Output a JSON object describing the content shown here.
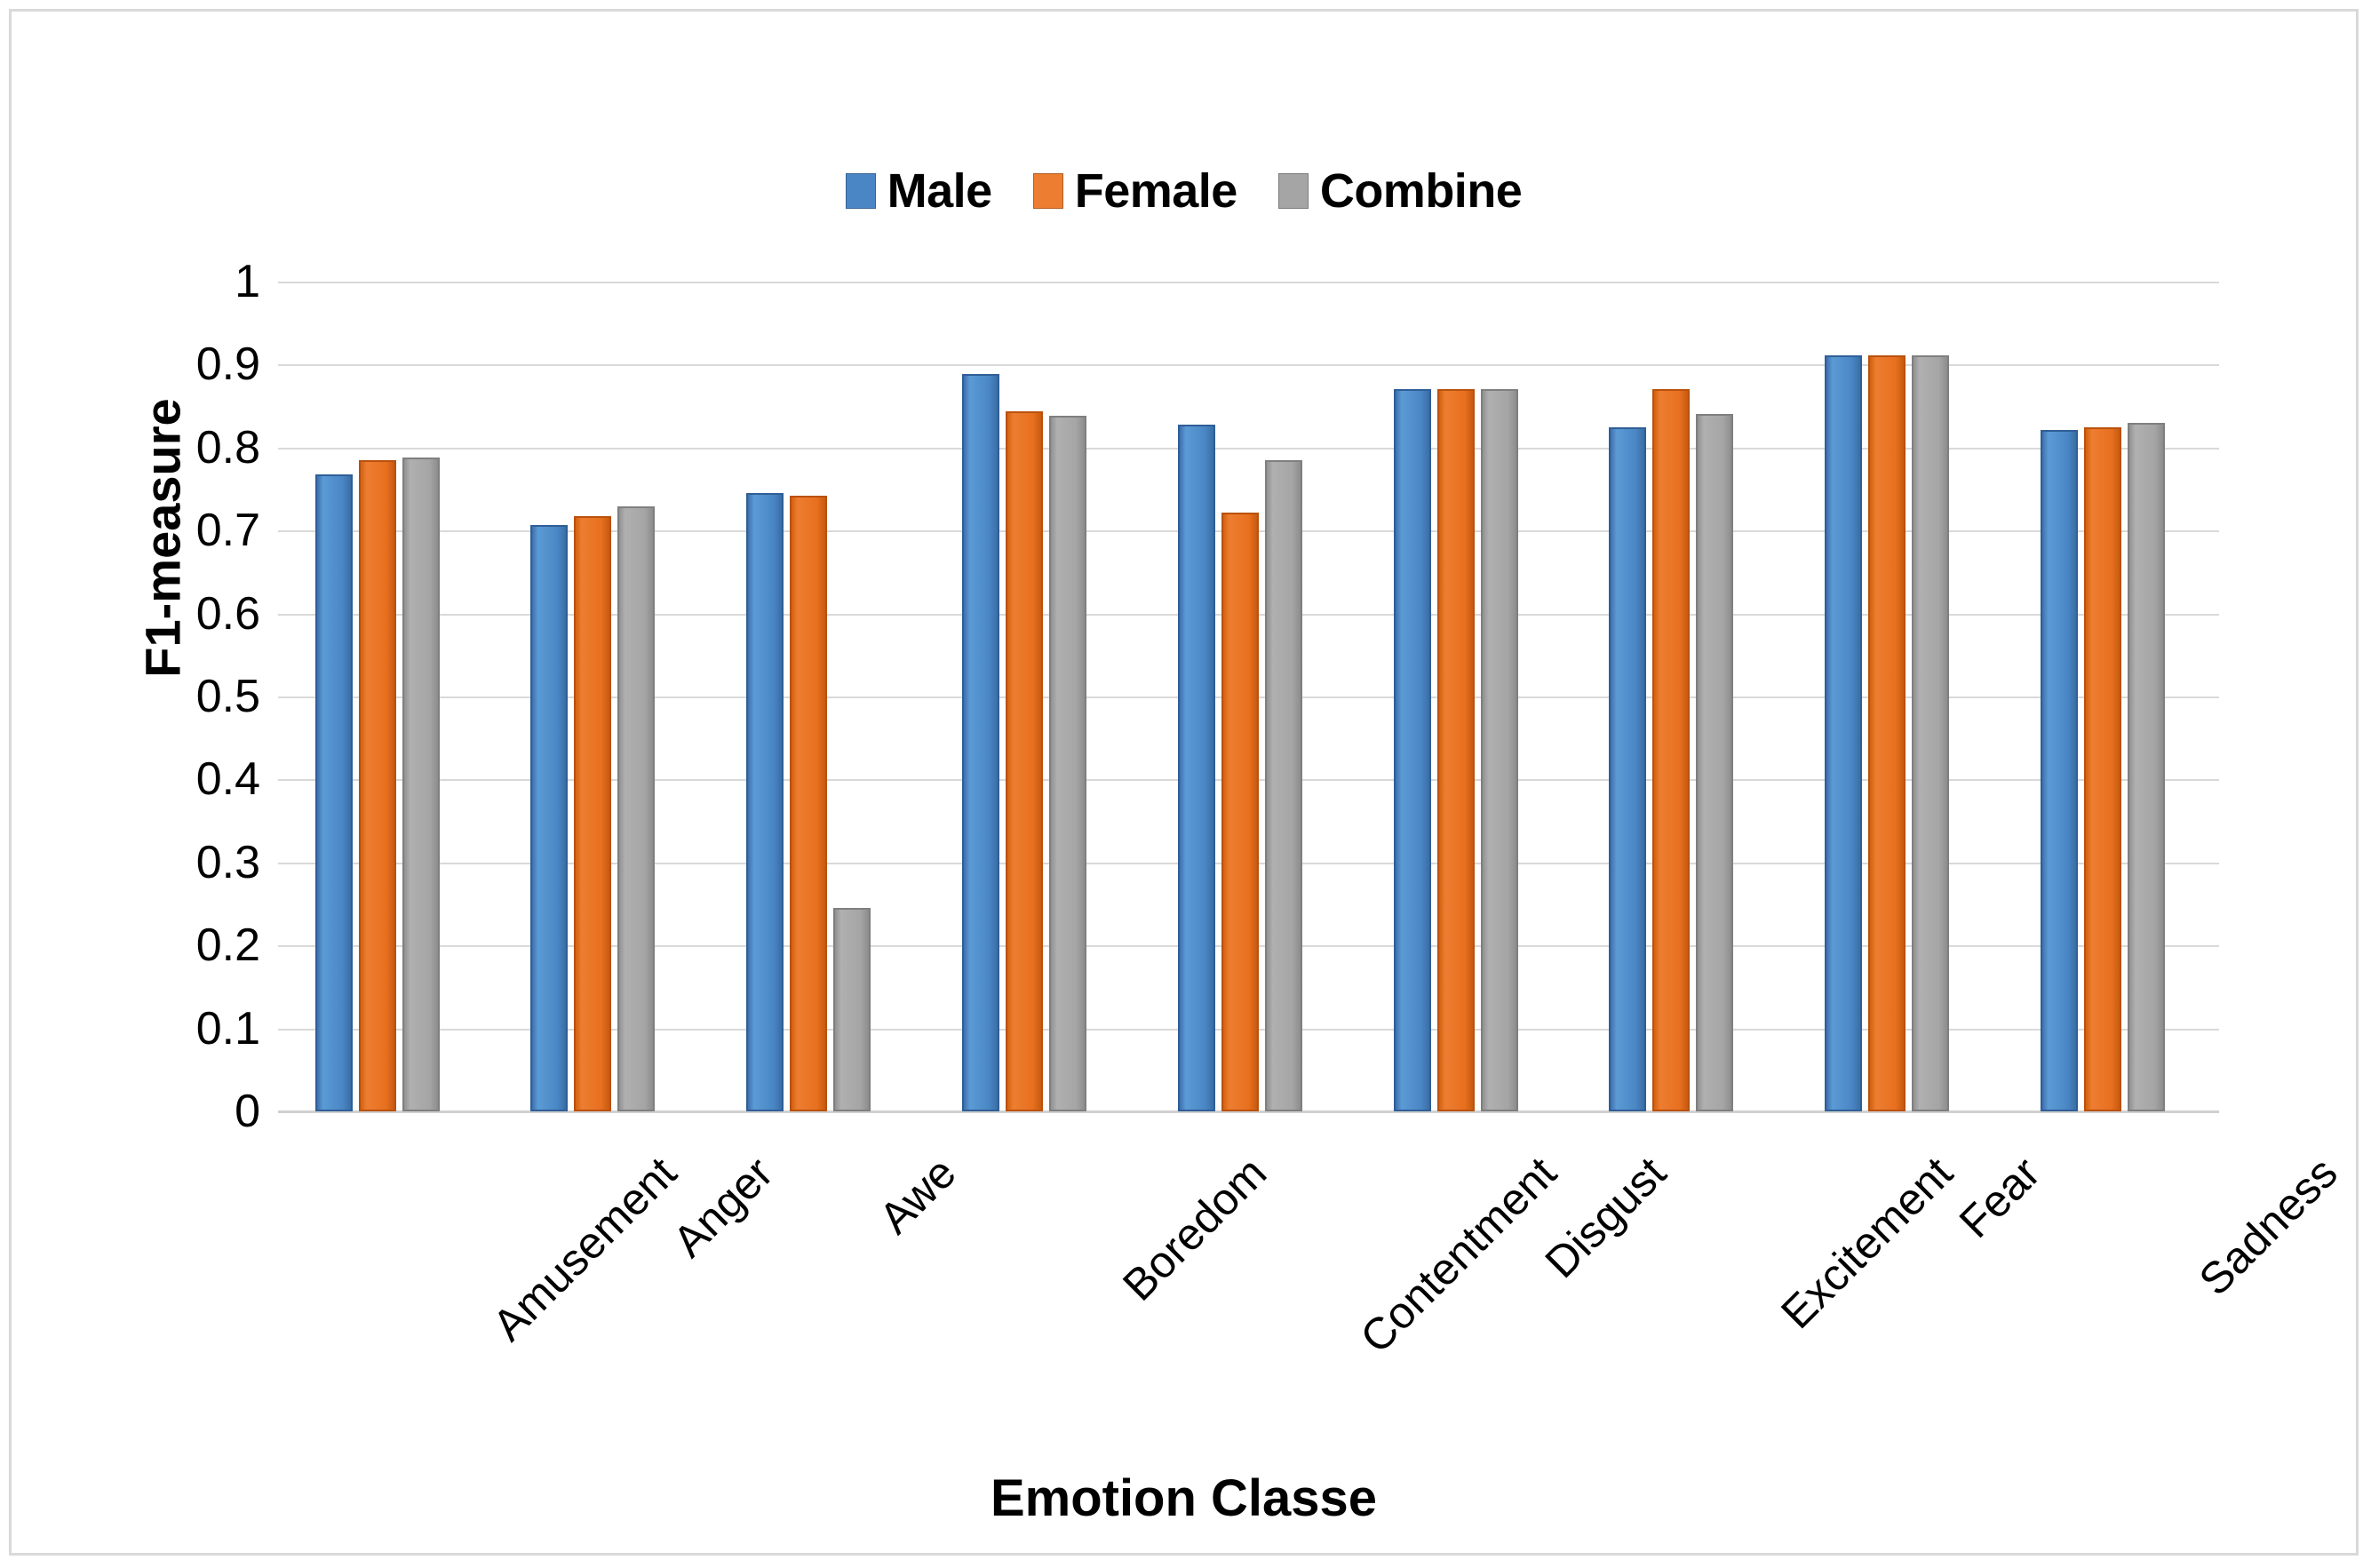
{
  "chart_data": {
    "type": "bar",
    "title": "",
    "xlabel": "Emotion Classe",
    "ylabel": "F1-measure",
    "ylim": [
      0,
      1
    ],
    "ytick_labels": [
      "1",
      "0.9",
      "0.8",
      "0.7",
      "0.6",
      "0.5",
      "0.4",
      "0.3",
      "0.2",
      "0.1",
      "0"
    ],
    "ytick_values": [
      1,
      0.9,
      0.8,
      0.7,
      0.6,
      0.5,
      0.4,
      0.3,
      0.2,
      0.1,
      0
    ],
    "grid": true,
    "legend_position": "top-center",
    "categories": [
      "Amusement",
      "Anger",
      "Awe",
      "Boredom",
      "Contentment",
      "Disgust",
      "Excitement",
      "Fear",
      "Sadness"
    ],
    "series": [
      {
        "name": "Male",
        "color": "#4a86c5",
        "values": [
          0.768,
          0.707,
          0.745,
          0.889,
          0.828,
          0.871,
          0.824,
          0.911,
          0.821
        ]
      },
      {
        "name": "Female",
        "color": "#ed7d31",
        "values": [
          0.785,
          0.717,
          0.742,
          0.844,
          0.722,
          0.871,
          0.87,
          0.911,
          0.824
        ]
      },
      {
        "name": "Combine",
        "color": "#a5a5a5",
        "values": [
          0.788,
          0.729,
          0.245,
          0.838,
          0.785,
          0.871,
          0.841,
          0.911,
          0.83
        ]
      }
    ]
  },
  "legend": {
    "items": [
      {
        "label": "Male",
        "color": "#4a86c5"
      },
      {
        "label": "Female",
        "color": "#ed7d31"
      },
      {
        "label": "Combine",
        "color": "#a5a5a5"
      }
    ]
  },
  "axes": {
    "y_title": "F1-measure",
    "x_title": "Emotion Classe"
  },
  "colors": {
    "border": "#d9d9d9",
    "gridline": "#d9d9d9",
    "background": "#ffffff",
    "text": "#000000"
  }
}
